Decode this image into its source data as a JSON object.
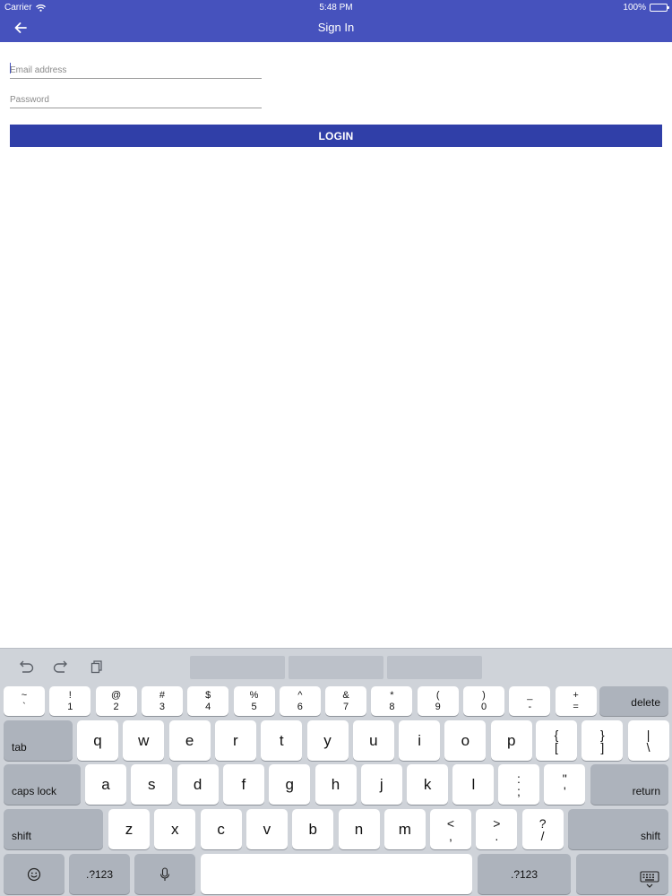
{
  "status_bar": {
    "carrier": "Carrier",
    "time": "5:48 PM",
    "battery": "100%"
  },
  "nav": {
    "title": "Sign In",
    "back_icon": "arrow-left-icon"
  },
  "form": {
    "email_placeholder": "Email address",
    "password_placeholder": "Password",
    "login_label": "LOGIN"
  },
  "colors": {
    "header": "#4652bd",
    "login_button": "#303fa8",
    "keyboard_bg": "#cfd3d9"
  },
  "keyboard": {
    "row1": [
      {
        "top": "~",
        "bottom": "`"
      },
      {
        "top": "!",
        "bottom": "1"
      },
      {
        "top": "@",
        "bottom": "2"
      },
      {
        "top": "#",
        "bottom": "3"
      },
      {
        "top": "$",
        "bottom": "4"
      },
      {
        "top": "%",
        "bottom": "5"
      },
      {
        "top": "^",
        "bottom": "6"
      },
      {
        "top": "&",
        "bottom": "7"
      },
      {
        "top": "*",
        "bottom": "8"
      },
      {
        "top": "(",
        "bottom": "9"
      },
      {
        "top": ")",
        "bottom": "0"
      },
      {
        "top": "_",
        "bottom": "-"
      },
      {
        "top": "+",
        "bottom": "="
      }
    ],
    "delete": "delete",
    "tab": "tab",
    "row2": [
      "q",
      "w",
      "e",
      "r",
      "t",
      "y",
      "u",
      "i",
      "o",
      "p"
    ],
    "row2_extra": [
      {
        "top": "{",
        "bottom": "["
      },
      {
        "top": "}",
        "bottom": "]"
      },
      {
        "top": "|",
        "bottom": "\\"
      }
    ],
    "caps_lock": "caps lock",
    "row3": [
      "a",
      "s",
      "d",
      "f",
      "g",
      "h",
      "j",
      "k",
      "l"
    ],
    "row3_extra": [
      {
        "top": ":",
        "bottom": ";"
      },
      {
        "top": "\"",
        "bottom": "'"
      }
    ],
    "return": "return",
    "shift": "shift",
    "row4": [
      "z",
      "x",
      "c",
      "v",
      "b",
      "n",
      "m"
    ],
    "row4_extra": [
      {
        "top": "<",
        "bottom": ","
      },
      {
        "top": ">",
        "bottom": "."
      },
      {
        "top": "?",
        "bottom": "/"
      }
    ],
    "numbers_key": ".?123",
    "icons": [
      "undo-icon",
      "redo-icon",
      "paste-icon",
      "emoji-icon",
      "microphone-icon",
      "keyboard-dismiss-icon"
    ]
  }
}
